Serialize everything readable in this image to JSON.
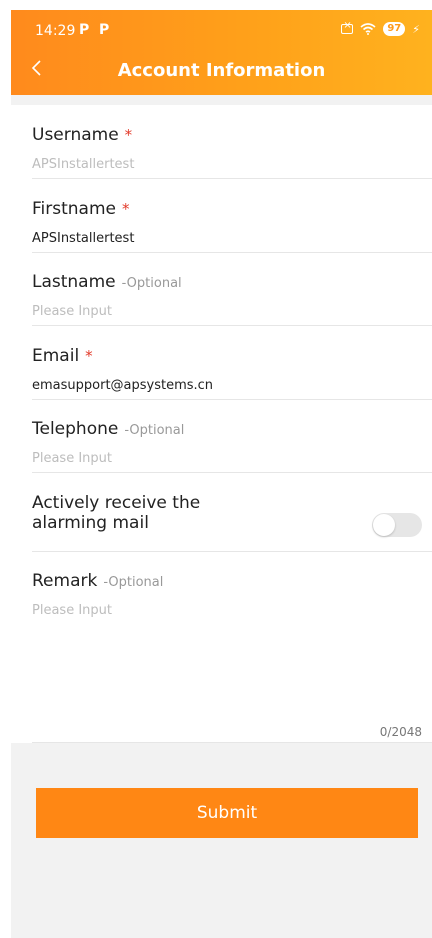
{
  "status_bar": {
    "time": "14:29",
    "battery": "97"
  },
  "header": {
    "title": "Account Information"
  },
  "fields": {
    "username": {
      "label": "Username",
      "required": "*",
      "value": "APSInstallertest"
    },
    "firstname": {
      "label": "Firstname",
      "required": "*",
      "value": "APSInstallertest"
    },
    "lastname": {
      "label": "Lastname",
      "optional": "-Optional",
      "placeholder": "Please Input"
    },
    "email": {
      "label": "Email",
      "required": "*",
      "value": "emasupport@apsystems.cn"
    },
    "telephone": {
      "label": "Telephone",
      "optional": "-Optional",
      "placeholder": "Please Input"
    },
    "alarm_mail": {
      "label_line1": "Actively receive the",
      "label_line2": "alarming mail",
      "enabled": false
    },
    "remark": {
      "label": "Remark",
      "optional": "-Optional",
      "placeholder": "Please Input",
      "counter": "0/2048"
    }
  },
  "submit_label": "Submit",
  "colors": {
    "accent": "#ff8714",
    "required": "#e23a2a"
  }
}
